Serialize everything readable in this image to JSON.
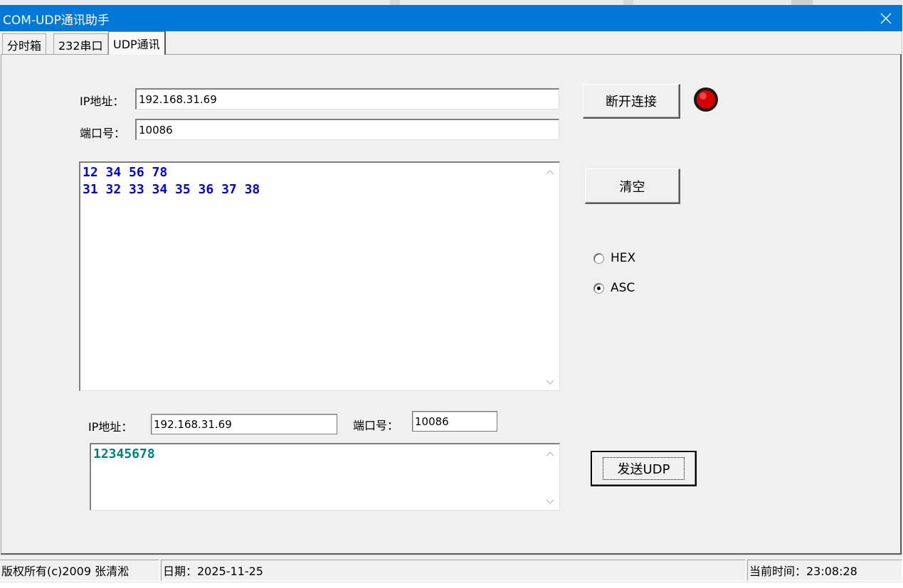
{
  "window": {
    "title": "COM-UDP通讯助手",
    "close_icon": "close-icon"
  },
  "tabs": [
    {
      "label": "分时箱",
      "selected": false
    },
    {
      "label": "232串口",
      "selected": false
    },
    {
      "label": "UDP通讯",
      "selected": true
    }
  ],
  "connection": {
    "ip_label": "IP地址：",
    "ip_value": "192.168.31.69",
    "port_label": "端口号：",
    "port_value": "10086",
    "disconnect_label": "断开连接",
    "status_led_color": "#e00000"
  },
  "receive": {
    "lines": [
      "12 34 56 78",
      "31 32 33 34 35 36 37 38"
    ],
    "text_color": "#0000e0",
    "clear_label": "清空"
  },
  "mode": {
    "options": [
      {
        "label": "HEX",
        "checked": false
      },
      {
        "label": "ASC",
        "checked": true
      }
    ]
  },
  "send": {
    "ip_label": "IP地址：",
    "ip_value": "192.168.31.69",
    "port_label": "端口号：",
    "port_value": "10086",
    "text": "12345678",
    "text_color": "#008080",
    "send_label": "发送UDP"
  },
  "statusbar": {
    "copyright": "版权所有(c)2009   张清淞",
    "date": "日期：2025-11-25",
    "time": "当前时间：23:08:28"
  }
}
